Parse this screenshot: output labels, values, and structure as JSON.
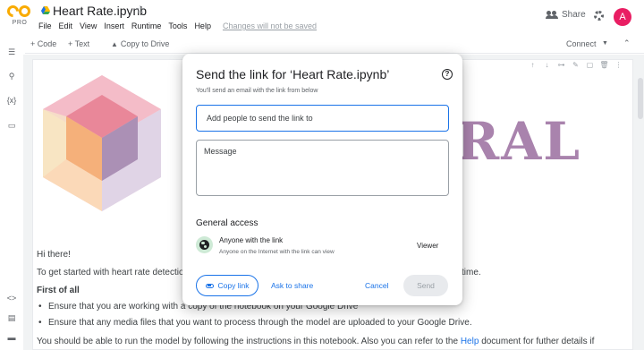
{
  "header": {
    "logo_sub": "PRO",
    "notebook_title": "Heart Rate.ipynb",
    "menus": [
      "File",
      "Edit",
      "View",
      "Insert",
      "Runtime",
      "Tools",
      "Help"
    ],
    "changes_notice": "Changes will not be saved",
    "share_label": "Share",
    "avatar_initial": "A"
  },
  "toolbar": {
    "add_code": "+ Code",
    "add_text": "+ Text",
    "copy_to_drive": "Copy to Drive",
    "connect": "Connect"
  },
  "notebook": {
    "banner_text": "RAL",
    "greeting": "Hi there!",
    "intro_start": "To get started with heart rate detectio",
    "intro_end": "time.",
    "first_heading": "First of all",
    "bullets": [
      "Ensure that you are working with a copy of the notebook on your Google Drive",
      "Ensure that any media files that you want to process through the model are uploaded to your Google Drive."
    ],
    "footer_start": "You should be able to run the model by following the instructions in this notebook. Also you can refer to the",
    "footer_link": "Help",
    "footer_end": "document for futher details if"
  },
  "dialog": {
    "title": "Send the link for ‘Heart Rate.ipynb’",
    "subtitle": "You'll send an email with the link from below",
    "people_placeholder": "Add people to send the link to",
    "message_placeholder": "Message",
    "general_access": "General access",
    "access_title": "Anyone with the link",
    "access_desc": "Anyone on the Internet with the link can view",
    "role": "Viewer",
    "copy_link": "Copy link",
    "ask_to_share": "Ask to share",
    "cancel": "Cancel",
    "send": "Send"
  },
  "colors": {
    "accent": "#1a73e8",
    "avatar": "#e91e63",
    "logo": "#f9ab00",
    "banner": "#a983ad"
  }
}
